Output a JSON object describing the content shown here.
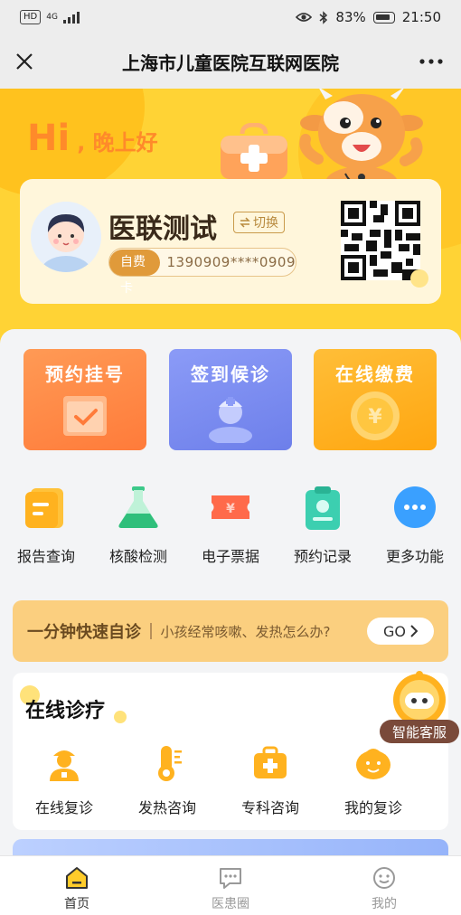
{
  "status_bar": {
    "hd": "HD",
    "network": "4G",
    "battery": "83%",
    "time": "21:50"
  },
  "title_bar": {
    "title": "上海市儿童医院互联网医院"
  },
  "hero": {
    "greeting_hi": "Hi",
    "greeting_sub": ", 晚上好",
    "user": {
      "name": "医联测试",
      "switch_label": "切换",
      "card_type": "自费卡",
      "card_number": "1390909****0909"
    }
  },
  "main_actions": [
    {
      "label": "预约挂号",
      "color": "#ff8c45"
    },
    {
      "label": "签到候诊",
      "color": "#7a8cf2"
    },
    {
      "label": "在线缴费",
      "color": "#ffb21f"
    }
  ],
  "quick_links": [
    {
      "label": "报告查询",
      "icon": "report-icon"
    },
    {
      "label": "核酸检测",
      "icon": "flask-icon"
    },
    {
      "label": "电子票据",
      "icon": "ticket-icon"
    },
    {
      "label": "预约记录",
      "icon": "clipboard-icon"
    },
    {
      "label": "更多功能",
      "icon": "more-icon"
    }
  ],
  "self_diagnosis": {
    "title": "一分钟快速自诊",
    "subtitle": "小孩经常咳嗽、发热怎么办?",
    "go_label": "GO"
  },
  "online_consult": {
    "title": "在线诊疗",
    "items": [
      {
        "label": "在线复诊",
        "icon": "doctor-icon"
      },
      {
        "label": "发热咨询",
        "icon": "thermometer-icon"
      },
      {
        "label": "专科咨询",
        "icon": "medical-bag-icon"
      },
      {
        "label": "我的复诊",
        "icon": "smiley-icon"
      }
    ]
  },
  "customer_service": {
    "label": "智能客服"
  },
  "bottom_nav": [
    {
      "label": "首页",
      "icon": "home-icon",
      "active": true
    },
    {
      "label": "医患圈",
      "icon": "chat-icon",
      "active": false
    },
    {
      "label": "我的",
      "icon": "profile-icon",
      "active": false
    }
  ],
  "colors": {
    "brand_yellow": "#ffd335",
    "accent_orange": "#ff8a2a"
  }
}
